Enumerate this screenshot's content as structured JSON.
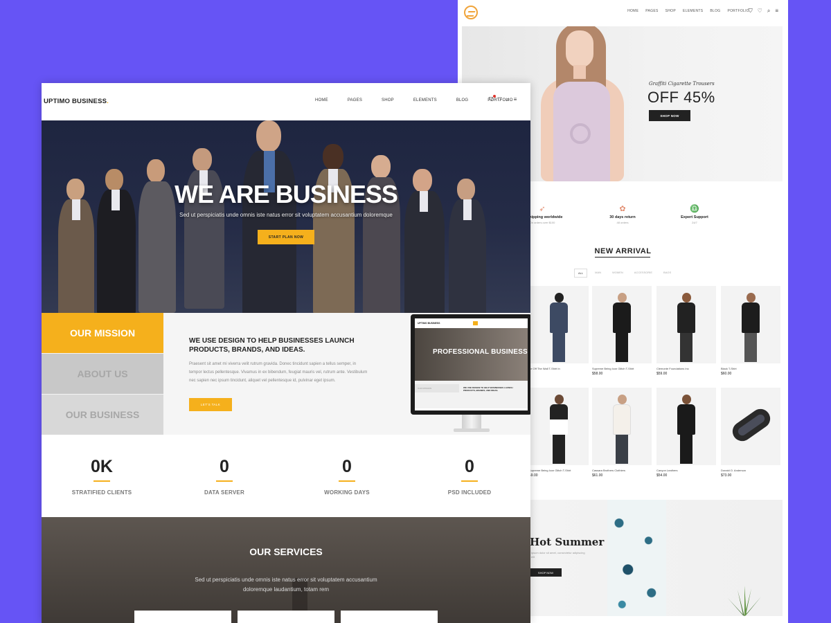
{
  "shop": {
    "logo_icon": "circle-swirl-logo",
    "menu": [
      "HOME",
      "PAGES",
      "SHOP",
      "ELEMENTS",
      "BLOG",
      "PORTFOLIO"
    ],
    "hero": {
      "subtitle": "Graffiti Cigarette Trousers",
      "title": "OFF 45%",
      "button": "SHOP NOW"
    },
    "features": [
      {
        "title": "ee shipping worldwide",
        "sub": "On orders over $100"
      },
      {
        "title": "30 days return",
        "sub": "48 orders"
      },
      {
        "title": "Expert Support",
        "sub": "24/7"
      }
    ],
    "new_arrival": {
      "title": "NEW ARRIVAL",
      "tabs": [
        "ALL",
        "MAN",
        "WOMEN",
        "ACCESSORIE",
        "BAGS"
      ]
    },
    "products": [
      {
        "name": "ne Off The Wall T-Shirt In",
        "price": ""
      },
      {
        "name": "Supreme Being Icon Glitch T-Shirt",
        "price": "$58.00"
      },
      {
        "name": "Clemonte Foundations Inc",
        "price": "$59.00"
      },
      {
        "name": "Black T-Shirt",
        "price": "$60.00"
      },
      {
        "name": "Supreme Being Icon Glitch T-Shirt",
        "price": "59.00"
      },
      {
        "name": "Cassara Brothers Clothiers",
        "price": "$61.00"
      },
      {
        "name": "Canyon Leathers",
        "price": "$54.00"
      },
      {
        "name": "Donald O. Anderson",
        "price": "$73.00"
      }
    ],
    "summer": {
      "title": "Hot Summer",
      "text": "ipsum dolor sit amet, consectetur adipiscing elit",
      "button": "SHOP NOW"
    }
  },
  "biz": {
    "logo": "UPTIMO BUSINESS",
    "logo_dot": ".",
    "menu": [
      "HOME",
      "PAGES",
      "SHOP",
      "ELEMENTS",
      "BLOG",
      "PORTFOLIO"
    ],
    "hero": {
      "title": "WE ARE BUSINESS",
      "text": "Sed ut perspiciatis unde omnis iste natus error sit voluptatem accusantium doloremque",
      "button": "START PLAN NOW"
    },
    "tabs": [
      "OUR MISSION",
      "ABOUT US",
      "OUR BUSINESS"
    ],
    "mission": {
      "heading": "WE USE DESIGN TO HELP BUSINESSES LAUNCH PRODUCTS, BRANDS, AND IDEAS.",
      "body": "Praesent sit amet mi viverra velit rutrum gravida. Donec tincidunt sapien a tellus semper, in tempor lectus pellentesque. Vivamus in ex bibendum, feugiat mauris vel, rutrum ante. Vestibulum nec sapien nec ipsum tincidunt, aliquet vel pellentesque id, pulvinar eget ipsum.",
      "button": "LET'S TALK"
    },
    "monitor": {
      "logo": "UPTIMO BUSINESS",
      "title": "PROFESSIONAL BUSINESS",
      "tab": "OUR MISSION",
      "text": "WE USE DESIGN TO HELP BUSINESSES LAUNCH PRODUCTS, BRANDS, AND IDEAS."
    },
    "stats": [
      {
        "value": "0K",
        "label": "STRATIFIED CLIENTS"
      },
      {
        "value": "0",
        "label": "DATA SERVER"
      },
      {
        "value": "0",
        "label": "WORKING DAYS"
      },
      {
        "value": "0",
        "label": "PSD INCLUDED"
      }
    ],
    "services": {
      "title": "OUR SERVICES",
      "text": "Sed ut perspiciatis unde omnis iste natus error sit voluptatem accusantium doloremque laudantium, totam rem"
    },
    "colors": {
      "accent": "#f5b01c",
      "background": "#6654f5"
    }
  }
}
